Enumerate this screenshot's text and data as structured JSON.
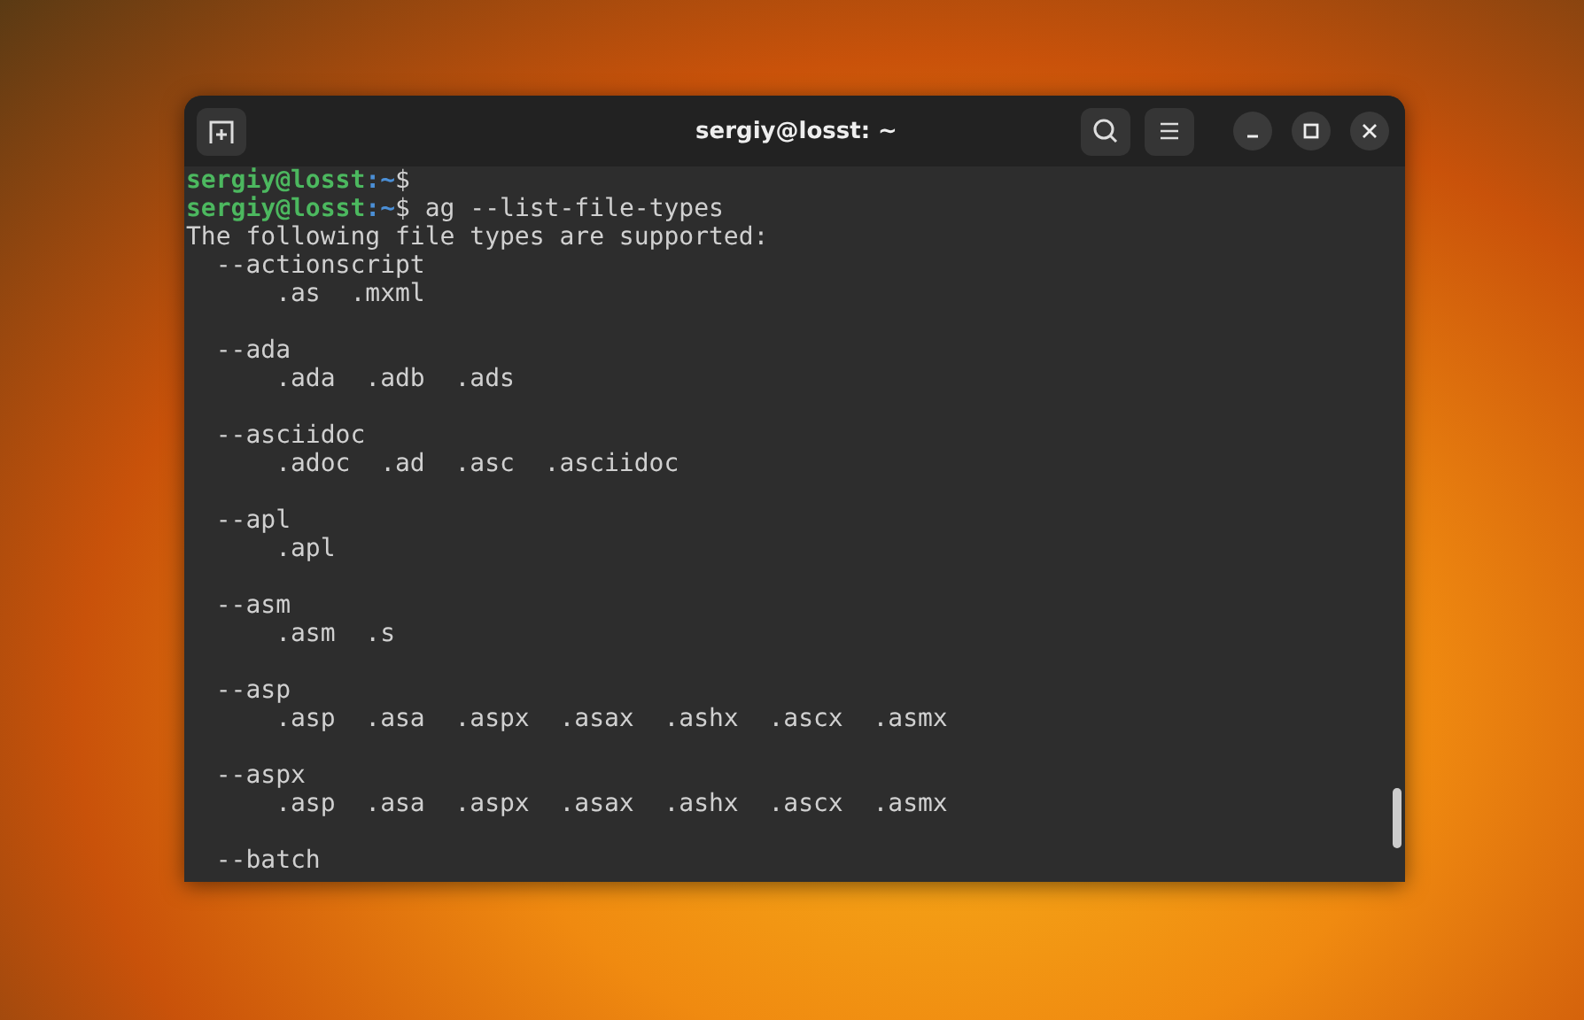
{
  "window": {
    "title": "sergiy@losst: ~"
  },
  "terminal": {
    "lines": [
      {
        "kind": "prompt",
        "user_host": "sergiy@losst",
        "path": ":~",
        "symbol": "$"
      },
      {
        "kind": "prompt",
        "user_host": "sergiy@losst",
        "path": ":~",
        "symbol": "$",
        "command": " ag --list-file-types"
      },
      {
        "kind": "output",
        "text": "The following file types are supported:"
      },
      {
        "kind": "output",
        "text": "  --actionscript"
      },
      {
        "kind": "output",
        "text": "      .as  .mxml"
      },
      {
        "kind": "blank"
      },
      {
        "kind": "output",
        "text": "  --ada"
      },
      {
        "kind": "output",
        "text": "      .ada  .adb  .ads"
      },
      {
        "kind": "blank"
      },
      {
        "kind": "output",
        "text": "  --asciidoc"
      },
      {
        "kind": "output",
        "text": "      .adoc  .ad  .asc  .asciidoc"
      },
      {
        "kind": "blank"
      },
      {
        "kind": "output",
        "text": "  --apl"
      },
      {
        "kind": "output",
        "text": "      .apl"
      },
      {
        "kind": "blank"
      },
      {
        "kind": "output",
        "text": "  --asm"
      },
      {
        "kind": "output",
        "text": "      .asm  .s"
      },
      {
        "kind": "blank"
      },
      {
        "kind": "output",
        "text": "  --asp"
      },
      {
        "kind": "output",
        "text": "      .asp  .asa  .aspx  .asax  .ashx  .ascx  .asmx"
      },
      {
        "kind": "blank"
      },
      {
        "kind": "output",
        "text": "  --aspx"
      },
      {
        "kind": "output",
        "text": "      .asp  .asa  .aspx  .asax  .ashx  .ascx  .asmx"
      },
      {
        "kind": "blank"
      },
      {
        "kind": "output",
        "text": "  --batch"
      }
    ]
  }
}
